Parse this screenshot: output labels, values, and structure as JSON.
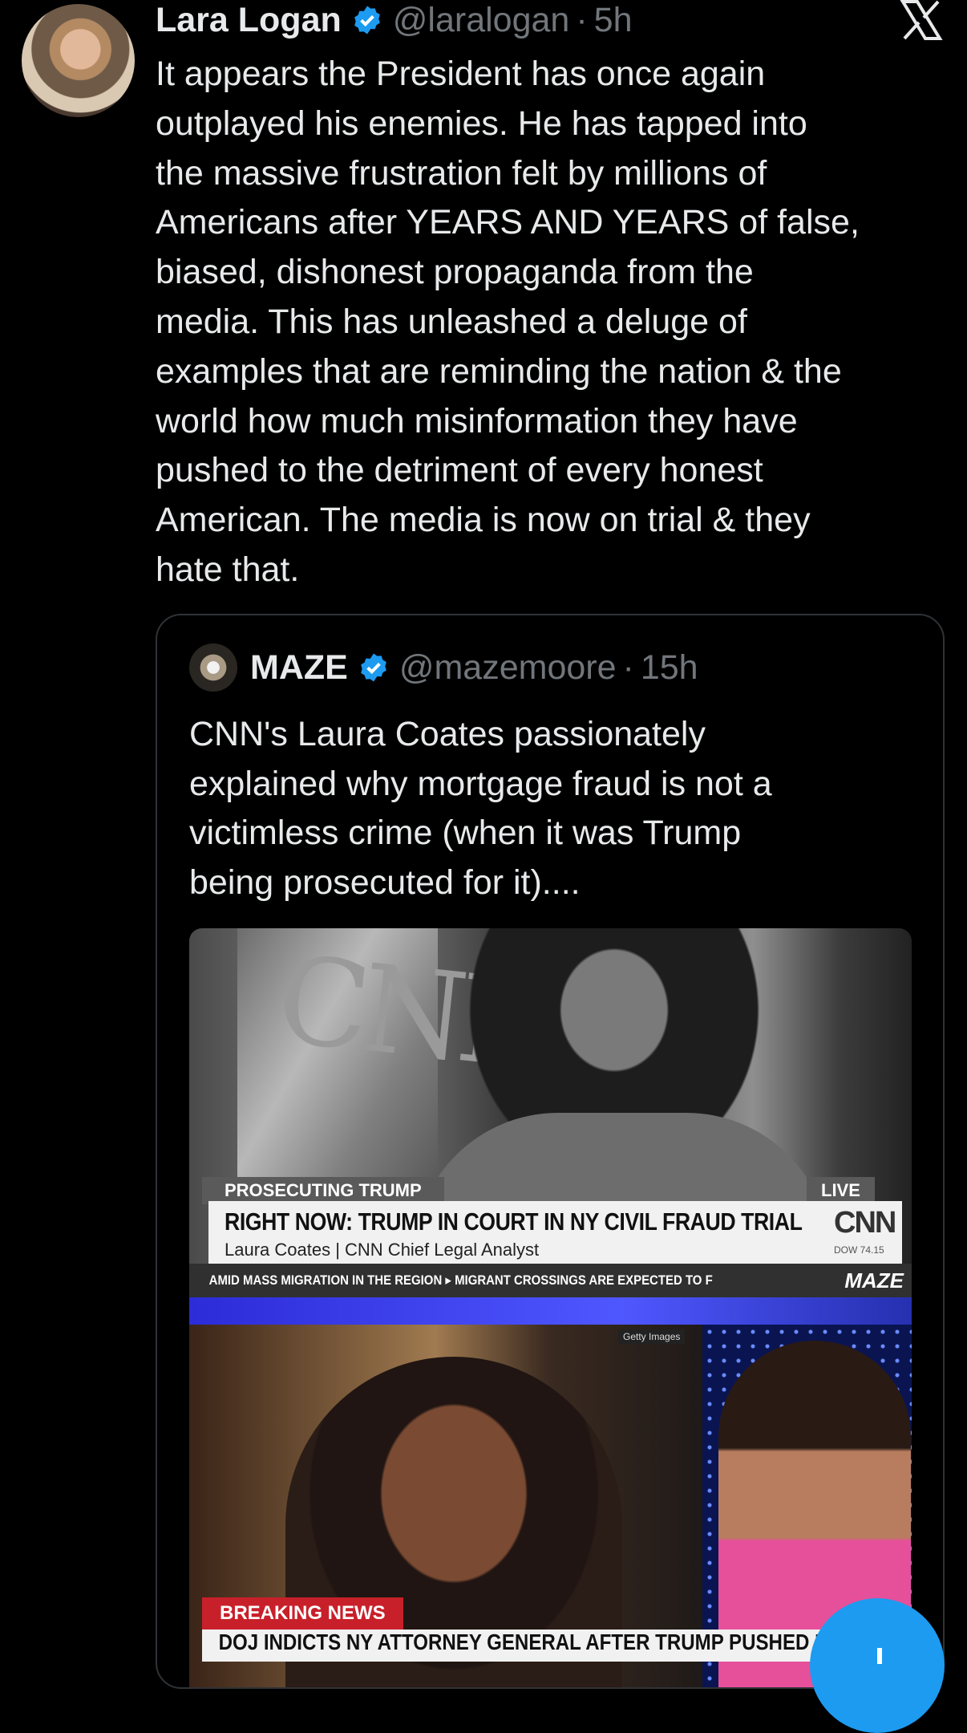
{
  "author": {
    "name": "Lara Logan",
    "handle": "@laralogan",
    "separator": "·",
    "time": "5h"
  },
  "post": {
    "text": "It appears the President has once again\noutplayed his enemies. He has tapped into\nthe massive frustration felt by millions of\nAmericans after YEARS AND YEARS of false,\nbiased, dishonest propaganda from the\nmedia. This has unleashed a deluge of\nexamples that are reminding the nation & the\nworld how much misinformation they have\npushed to the detriment of every honest\nAmerican. The media is now on trial & they\nhate that."
  },
  "quoted": {
    "name": "MAZE",
    "handle": "@mazemoore",
    "separator": "·",
    "time": "15h",
    "text": "CNN's Laura Coates passionately\nexplained why mortgage fraud is not a\nvictimless crime (when it was Trump\nbeing prosecuted for it)....",
    "media": {
      "frame1": {
        "label_small": "PROSECUTING TRUMP",
        "live": "LIVE",
        "headline": "RIGHT NOW: TRUMP IN COURT IN NY CIVIL FRAUD TRIAL",
        "sub": "Laura Coates  |  CNN  Chief Legal Analyst",
        "cnn_logo": "CNN",
        "dow": "DOW  74.15",
        "ticker": "AMID MASS MIGRATION IN THE REGION   ▸  MIGRANT CROSSINGS ARE EXPECTED TO F",
        "watermark": "MAZE",
        "wall_logo": "CNN"
      },
      "frame2": {
        "getty": "Getty Images",
        "breaking": "BREAKING NEWS",
        "headline": "DOJ INDICTS NY ATTORNEY GENERAL AFTER TRUMP PUSHED PROSECUTION"
      }
    }
  },
  "colors": {
    "background": "#000000",
    "text": "#e7e9ea",
    "muted": "#71767b",
    "verified": "#1d9bf0",
    "border": "#2f3336",
    "fab": "#1d9bf0"
  },
  "icons": [
    "verified-badge-icon",
    "x-logo-icon",
    "mute-icon",
    "plus-icon"
  ]
}
